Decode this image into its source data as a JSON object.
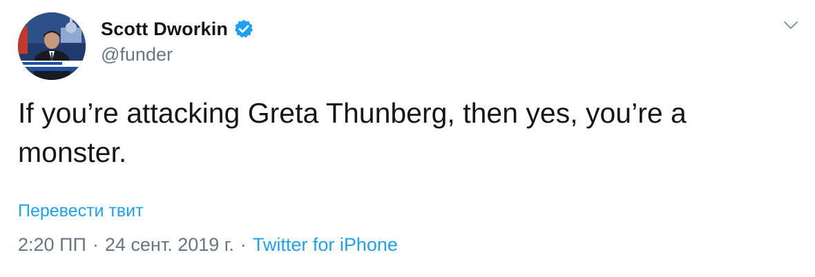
{
  "tweet": {
    "author": {
      "display_name": "Scott Dworkin",
      "handle": "@funder",
      "verified": true,
      "avatar_icon": "avatar-photo"
    },
    "text": "If you’re attacking Greta Thunberg, then yes, you’re a monster.",
    "translate_label": "Перевести твит",
    "meta": {
      "time": "2:20 ПП",
      "separator": "·",
      "date": "24 сент. 2019 г.",
      "source": "Twitter for iPhone"
    },
    "menu_icon": "chevron-down-icon"
  },
  "colors": {
    "text_primary": "#14171a",
    "text_secondary": "#657786",
    "link": "#1da1f2",
    "verified_badge": "#1da1f2",
    "background": "#ffffff"
  }
}
